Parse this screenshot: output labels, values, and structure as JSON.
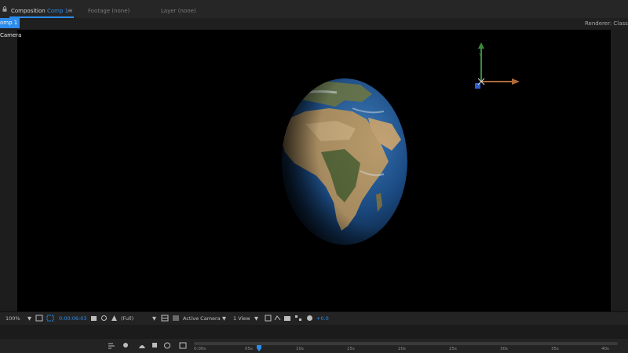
{
  "panel_tabs": {
    "composition_prefix": "Composition",
    "composition_name": "Comp 1",
    "composition_menu": "≡",
    "footage": "Footage (none)",
    "layer": "Layer (none)"
  },
  "comp_subtab": "omp 1",
  "renderer": "Renderer:  Classic",
  "camera_label": "Camera",
  "viewer_controls": {
    "zoom": "100%",
    "timecode": "0:00:06:03",
    "resolution": "(Full)",
    "active_camera": "Active Camera",
    "view_layout": "1 View",
    "exposure": "+0.0"
  },
  "timeline": {
    "ticks": [
      "0:00s",
      "05s",
      "10s",
      "15s",
      "20s",
      "25s",
      "30s",
      "35s",
      "40s"
    ]
  },
  "colors": {
    "accent": "#2d8ceb",
    "viewer_bg": "#000000",
    "panel_bg": "#232323"
  }
}
